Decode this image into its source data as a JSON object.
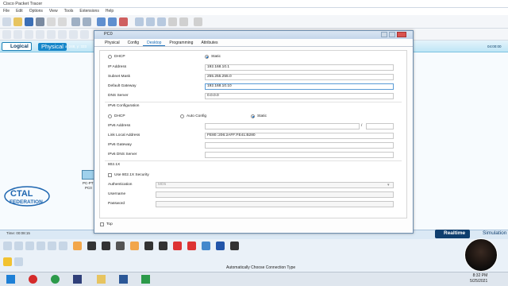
{
  "app": {
    "title": "Cisco Packet Tracer"
  },
  "menu": [
    "File",
    "Edit",
    "Options",
    "View",
    "Tools",
    "Extensions",
    "Help"
  ],
  "nav": {
    "logical": "Logical",
    "physical": "Physical",
    "coords": "x: 248, y: 333",
    "right_time": "04:00:00"
  },
  "workspace": {
    "pc_label": "PC-PT",
    "pc_name": "PC0"
  },
  "dialog": {
    "title": "PC0",
    "tabs": [
      "Physical",
      "Config",
      "Desktop",
      "Programming",
      "Attributes"
    ],
    "active_tab": "Desktop",
    "ipv4": {
      "dhcp_label": "DHCP",
      "static_label": "Static",
      "ip_label": "IP Address",
      "ip_value": "192.168.10.1",
      "mask_label": "Subnet Mask",
      "mask_value": "255.255.255.0",
      "gw_label": "Default Gateway",
      "gw_value": "192.168.10.10",
      "dns_label": "DNS Server",
      "dns_value": "0.0.0.0"
    },
    "ipv6": {
      "section_label": "IPv6 Configuration",
      "dhcp_label": "DHCP",
      "auto_label": "Auto Config",
      "static_label": "Static",
      "addr_label": "IPv6 Address",
      "addr_value": "",
      "prefix_sep": "/",
      "link_label": "Link Local Address",
      "link_value": "FE80::206:2AFF:FE41:B280",
      "gw_label": "IPv6 Gateway",
      "dns_label": "IPv6 DNS Server"
    },
    "dot1x": {
      "section_label": "802.1X",
      "use_label": "Use 802.1X Security",
      "auth_label": "Authentication",
      "auth_value": "MD5",
      "user_label": "Username",
      "pass_label": "Password"
    },
    "top_label": "Top"
  },
  "bottom": {
    "time_label": "Time: 00:08:15",
    "realtime": "Realtime",
    "simulation": "Simulation",
    "status": "Automatically Choose Connection Type"
  },
  "logo": {
    "line1": "CTAL",
    "line2": "FEDERATION"
  },
  "clock": {
    "time": "8:32 PM",
    "date": "5/25/2021"
  },
  "colors": {
    "accent": "#1586c9",
    "realtime_bg": "#0e3e6e",
    "nav_bg": "#bfe6f6"
  }
}
